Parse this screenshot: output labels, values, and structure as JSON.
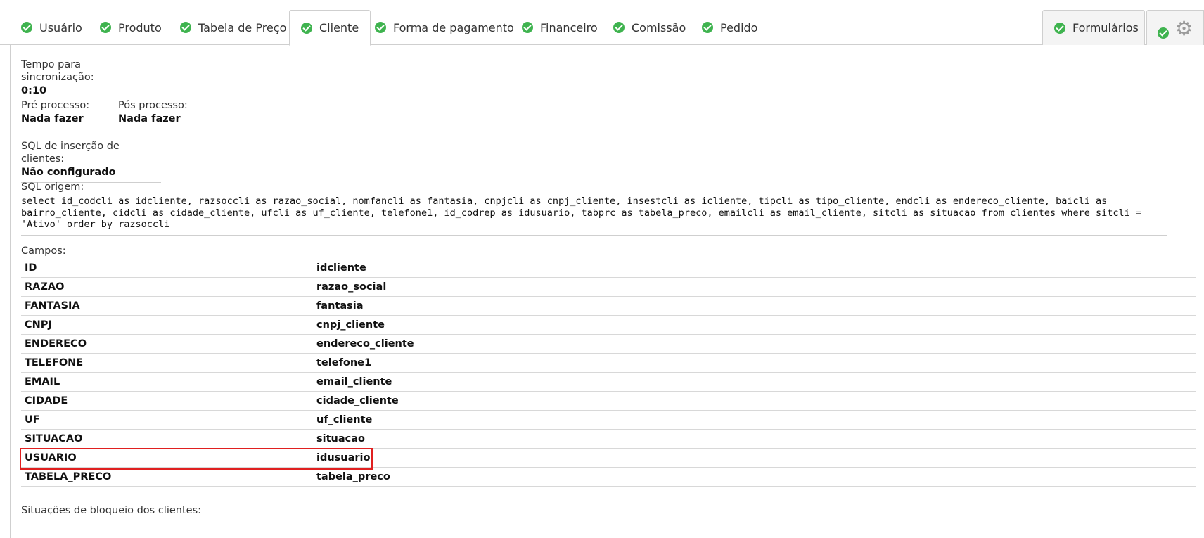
{
  "tabs": [
    {
      "label": "Usuário"
    },
    {
      "label": "Produto"
    },
    {
      "label": "Tabela de Preço"
    },
    {
      "label": "Cliente"
    },
    {
      "label": "Forma de pagamento"
    },
    {
      "label": "Financeiro"
    },
    {
      "label": "Comissão"
    },
    {
      "label": "Pedido"
    },
    {
      "label": "Formulários"
    }
  ],
  "sync": {
    "label": "Tempo para sincronização:",
    "value": "0:10"
  },
  "pre": {
    "label": "Pré processo:",
    "value": "Nada fazer"
  },
  "pos": {
    "label": "Pós processo:",
    "value": "Nada fazer"
  },
  "insert_sql": {
    "label": "SQL de inserção de clientes:",
    "value": "Não configurado"
  },
  "origin_sql": {
    "label": "SQL origem:",
    "value": "select id_codcli as idcliente, razsoccli as razao_social, nomfancli as fantasia, cnpjcli as cnpj_cliente, insestcli as icliente, tipcli as tipo_cliente, endcli as endereco_cliente, baicli as bairro_cliente, cidcli as cidade_cliente, ufcli as uf_cliente, telefone1, id_codrep as idusuario, tabprc as tabela_preco, emailcli as email_cliente, sitcli as situacao from clientes where sitcli = 'Ativo' order by razsoccli"
  },
  "fields_label": "Campos:",
  "fields": [
    {
      "key": "ID",
      "value": "idcliente"
    },
    {
      "key": "RAZAO",
      "value": "razao_social"
    },
    {
      "key": "FANTASIA",
      "value": "fantasia"
    },
    {
      "key": "CNPJ",
      "value": "cnpj_cliente"
    },
    {
      "key": "ENDERECO",
      "value": "endereco_cliente"
    },
    {
      "key": "TELEFONE",
      "value": "telefone1"
    },
    {
      "key": "EMAIL",
      "value": "email_cliente"
    },
    {
      "key": "CIDADE",
      "value": "cidade_cliente"
    },
    {
      "key": "UF",
      "value": "uf_cliente"
    },
    {
      "key": "SITUACAO",
      "value": "situacao"
    },
    {
      "key": "USUARIO",
      "value": "idusuario"
    },
    {
      "key": "TABELA_PRECO",
      "value": "tabela_preco"
    }
  ],
  "block_label": "Situações de bloqueio dos clientes:",
  "colors": {
    "check": "#3fb34f",
    "highlight": "#e02020"
  }
}
